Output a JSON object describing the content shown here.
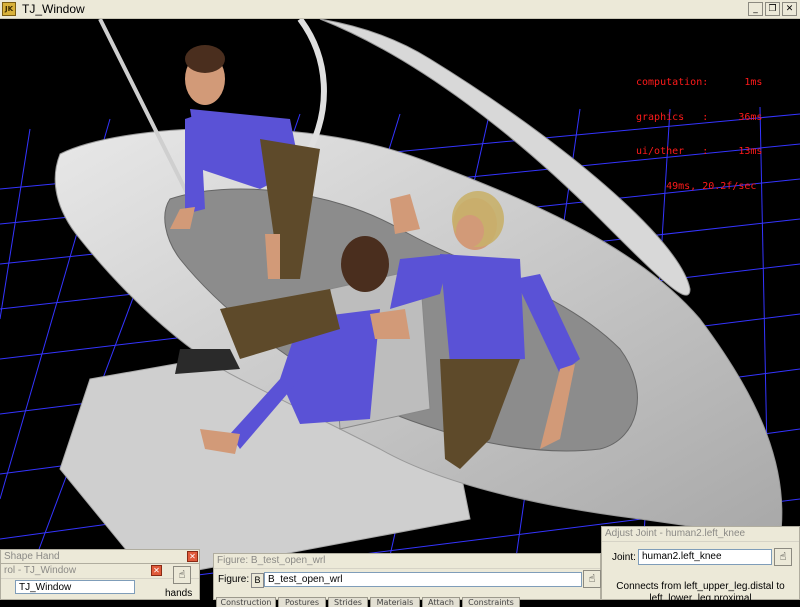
{
  "window": {
    "title": "TJ_Window",
    "icon": "jack-app-icon",
    "min_glyph": "_",
    "max_glyph": "❐",
    "close_glyph": "✕"
  },
  "stats": {
    "computation": "computation:      1ms",
    "graphics": "graphics   :     36ms",
    "ui_other": "ui/other   :     13ms",
    "total": "     49ms, 20.2f/sec"
  },
  "shape_hand": {
    "title": "Shape Hand",
    "close_glyph": "✕"
  },
  "control": {
    "title": "rol - TJ_Window",
    "field_value": "TJ_Window",
    "side_label": "hands",
    "close_glyph": "✕"
  },
  "figure": {
    "title": "Figure: B_test_open_wrl",
    "label": "Figure:",
    "type_badge": "B",
    "field_value": "B_test_open_wrl",
    "tabs": [
      "Construction",
      "Postures",
      "Strides",
      "Materials",
      "Attach",
      "Constraints"
    ]
  },
  "adjust_joint": {
    "title": "Adjust Joint - human2.left_knee",
    "joint_label": "Joint:",
    "joint_value": "human2.left_knee",
    "connects_line1": "Connects from left_upper_leg.distal to",
    "connects_line2": "left_lower_leg.proximal"
  },
  "colors": {
    "grid": "#3434ff",
    "stats_text": "#ff1a1a",
    "shirt": "#5a52d6",
    "pants": "#5e4a2a",
    "skin": "#d29a78",
    "hull": "#d4d4d4"
  }
}
